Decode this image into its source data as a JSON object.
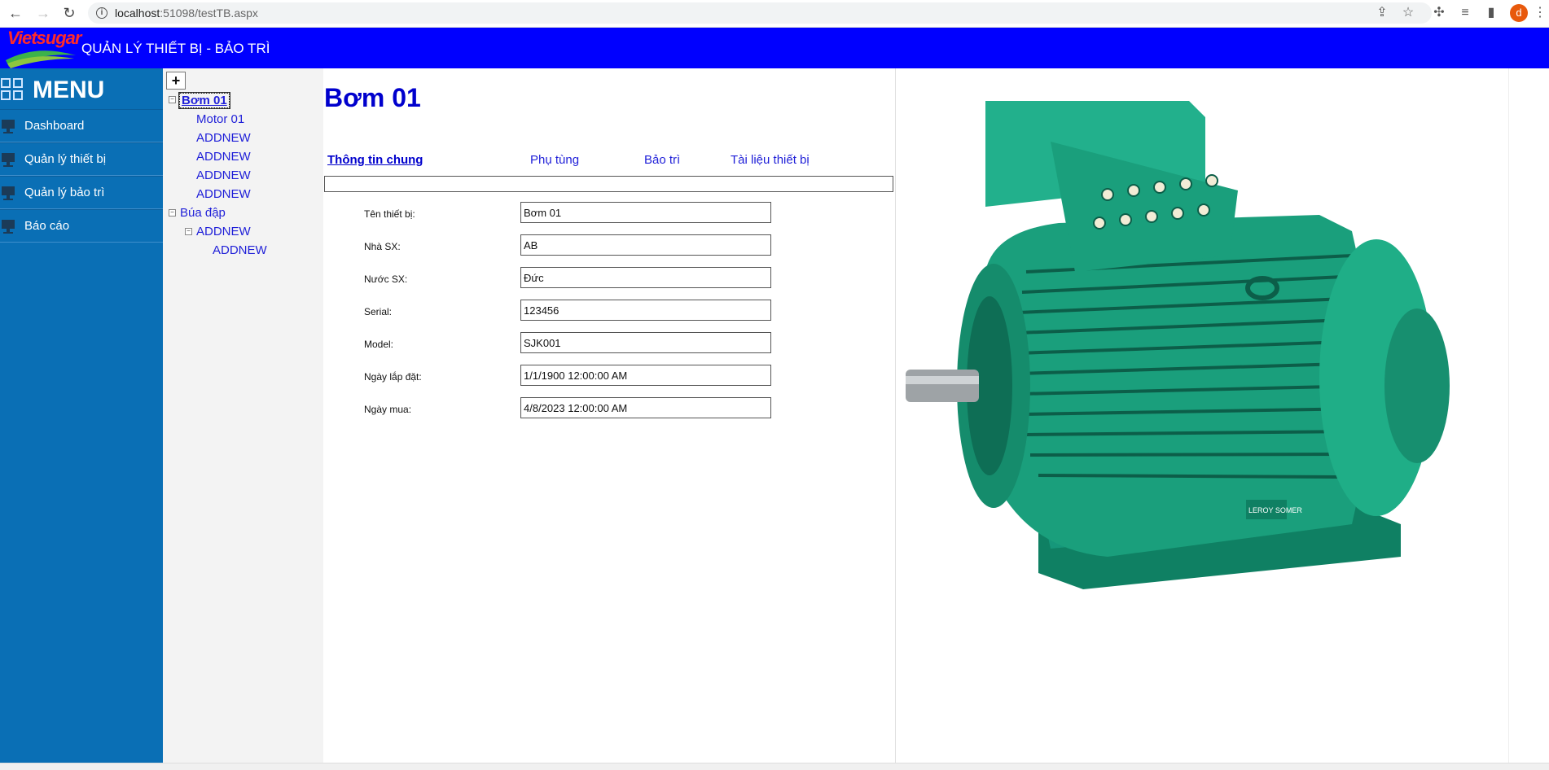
{
  "browser": {
    "url_host": "localhost",
    "url_path": ":51098/testTB.aspx",
    "profile_initial": "d"
  },
  "header": {
    "logo_text": "Vietsugar",
    "title": "QUẢN LÝ THIẾT BỊ - BẢO TRÌ"
  },
  "sidebar": {
    "menu_title": "MENU",
    "items": [
      {
        "label": "Dashboard"
      },
      {
        "label": "Quản lý thiết bị"
      },
      {
        "label": "Quản lý bảo trì"
      },
      {
        "label": "Báo cáo"
      }
    ]
  },
  "tree": {
    "add_label": "+",
    "nodes": [
      {
        "label": "Bơm 01"
      },
      {
        "label": "Motor 01"
      },
      {
        "label": "ADDNEW"
      },
      {
        "label": "ADDNEW"
      },
      {
        "label": "ADDNEW"
      },
      {
        "label": "ADDNEW"
      },
      {
        "label": "Búa đập"
      },
      {
        "label": "ADDNEW"
      },
      {
        "label": "ADDNEW"
      }
    ]
  },
  "main": {
    "title": "Bơm 01",
    "tabs": [
      {
        "label": "Thông tin chung"
      },
      {
        "label": "Phụ tùng"
      },
      {
        "label": "Bảo trì"
      },
      {
        "label": "Tài liệu thiết bị"
      }
    ],
    "fields": [
      {
        "label": "Tên thiết bị:",
        "value": "Bơm 01"
      },
      {
        "label": "Nhà SX:",
        "value": "AB"
      },
      {
        "label": "Nước SX:",
        "value": "Đức"
      },
      {
        "label": "Serial:",
        "value": "123456"
      },
      {
        "label": "Model:",
        "value": "SJK001"
      },
      {
        "label": "Ngày lắp đặt:",
        "value": "1/1/1900 12:00:00 AM"
      },
      {
        "label": "Ngày mua:",
        "value": "4/8/2023 12:00:00 AM"
      }
    ]
  },
  "image": {
    "brand_mark": "LEROY SOMER"
  },
  "colors": {
    "header_bg": "#0000ff",
    "sidebar_bg": "#0a6fb5",
    "link_blue": "#1f1fd8",
    "title_blue": "#0000cd",
    "motor_green": "#1a9f7c"
  }
}
